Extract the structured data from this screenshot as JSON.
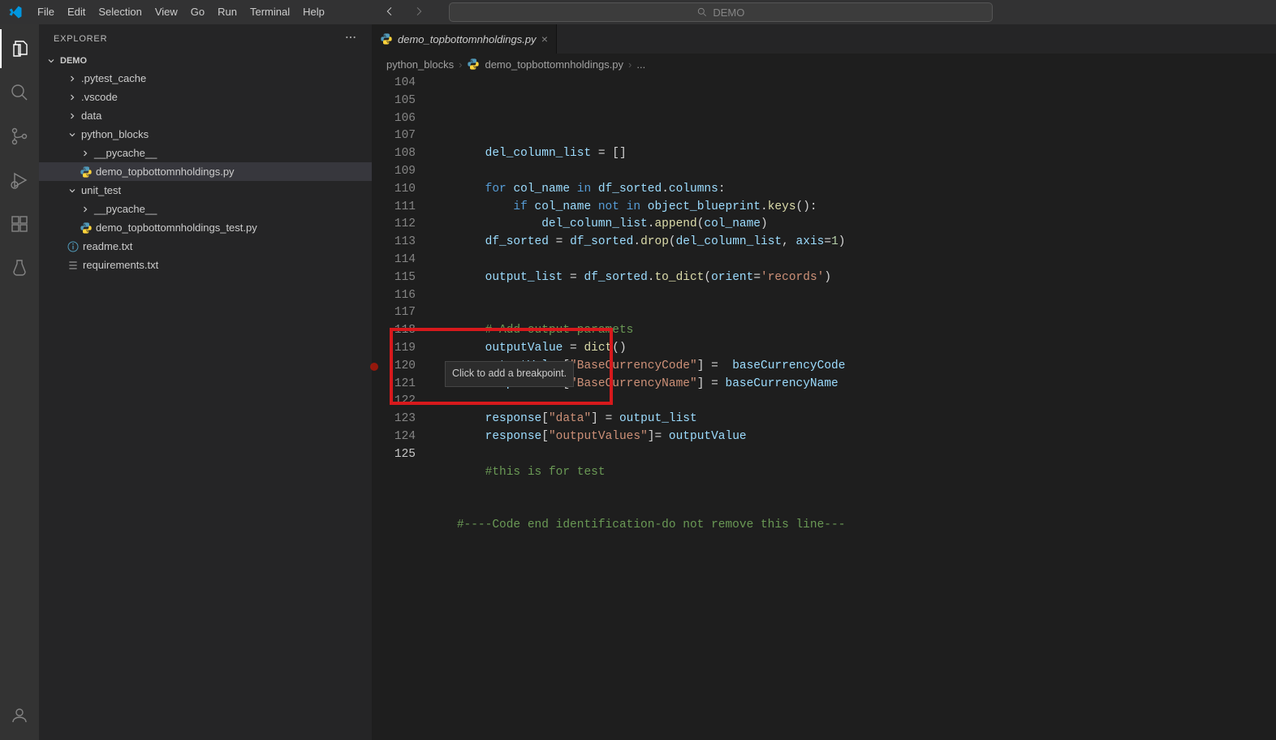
{
  "menubar": {
    "items": [
      "File",
      "Edit",
      "Selection",
      "View",
      "Go",
      "Run",
      "Terminal",
      "Help"
    ]
  },
  "search": {
    "text": "DEMO"
  },
  "explorer": {
    "title": "EXPLORER",
    "root": "DEMO",
    "tree": [
      {
        "name": ".pytest_cache",
        "kind": "folder-collapsed",
        "indent": 1
      },
      {
        "name": ".vscode",
        "kind": "folder-collapsed",
        "indent": 1
      },
      {
        "name": "data",
        "kind": "folder-collapsed",
        "indent": 1
      },
      {
        "name": "python_blocks",
        "kind": "folder-open",
        "indent": 1
      },
      {
        "name": "__pycache__",
        "kind": "folder-collapsed",
        "indent": 2
      },
      {
        "name": "demo_topbottomnholdings.py",
        "kind": "py",
        "indent": 2,
        "selected": true
      },
      {
        "name": "unit_test",
        "kind": "folder-open",
        "indent": 1
      },
      {
        "name": "__pycache__",
        "kind": "folder-collapsed",
        "indent": 2
      },
      {
        "name": "demo_topbottomnholdings_test.py",
        "kind": "py",
        "indent": 2
      },
      {
        "name": "readme.txt",
        "kind": "info",
        "indent": 1
      },
      {
        "name": "requirements.txt",
        "kind": "list",
        "indent": 1
      }
    ]
  },
  "tab": {
    "label": "demo_topbottomnholdings.py",
    "icon": "python"
  },
  "breadcrumbs": {
    "parts": [
      "python_blocks",
      "demo_topbottomnholdings.py",
      "..."
    ],
    "icon": "python"
  },
  "editor": {
    "startLine": 104,
    "currentLine": 125,
    "breakpointHoverLine": 120,
    "tooltip": "Click to add a breakpoint.",
    "lines": [
      {
        "n": 104,
        "tokens": [
          [
            "        ",
            ""
          ],
          [
            "del_column_list",
            "obj"
          ],
          [
            " = [",
            ""
          ],
          [
            "]",
            ""
          ]
        ]
      },
      {
        "n": 105,
        "tokens": [
          [
            "",
            ""
          ]
        ]
      },
      {
        "n": 106,
        "tokens": [
          [
            "        ",
            ""
          ],
          [
            "for",
            "kw"
          ],
          [
            " ",
            ""
          ],
          [
            "col_name",
            "obj"
          ],
          [
            " ",
            ""
          ],
          [
            "in",
            "kw"
          ],
          [
            " ",
            ""
          ],
          [
            "df_sorted",
            "obj"
          ],
          [
            ".",
            ""
          ],
          [
            "columns",
            "obj"
          ],
          [
            ":",
            ""
          ]
        ]
      },
      {
        "n": 107,
        "tokens": [
          [
            "            ",
            ""
          ],
          [
            "if",
            "kw"
          ],
          [
            " ",
            ""
          ],
          [
            "col_name",
            "obj"
          ],
          [
            " ",
            ""
          ],
          [
            "not",
            "kw"
          ],
          [
            " ",
            ""
          ],
          [
            "in",
            "kw"
          ],
          [
            " ",
            ""
          ],
          [
            "object_blueprint",
            "obj"
          ],
          [
            ".",
            ""
          ],
          [
            "keys",
            "fn"
          ],
          [
            "():",
            ""
          ]
        ]
      },
      {
        "n": 108,
        "tokens": [
          [
            "                ",
            ""
          ],
          [
            "del_column_list",
            "obj"
          ],
          [
            ".",
            ""
          ],
          [
            "append",
            "fn"
          ],
          [
            "(",
            ""
          ],
          [
            "col_name",
            "obj"
          ],
          [
            ")",
            ""
          ]
        ]
      },
      {
        "n": 109,
        "tokens": [
          [
            "        ",
            ""
          ],
          [
            "df_sorted",
            "obj"
          ],
          [
            " = ",
            ""
          ],
          [
            "df_sorted",
            "obj"
          ],
          [
            ".",
            ""
          ],
          [
            "drop",
            "fn"
          ],
          [
            "(",
            ""
          ],
          [
            "del_column_list",
            "obj"
          ],
          [
            ", ",
            ""
          ],
          [
            "axis",
            "obj"
          ],
          [
            "=",
            ""
          ],
          [
            "1",
            "num"
          ],
          [
            ")",
            ""
          ]
        ]
      },
      {
        "n": 110,
        "tokens": [
          [
            "",
            ""
          ]
        ]
      },
      {
        "n": 111,
        "tokens": [
          [
            "        ",
            ""
          ],
          [
            "output_list",
            "obj"
          ],
          [
            " = ",
            ""
          ],
          [
            "df_sorted",
            "obj"
          ],
          [
            ".",
            ""
          ],
          [
            "to_dict",
            "fn"
          ],
          [
            "(",
            ""
          ],
          [
            "orient",
            "obj"
          ],
          [
            "=",
            ""
          ],
          [
            "'records'",
            "str"
          ],
          [
            ")",
            ""
          ]
        ]
      },
      {
        "n": 112,
        "tokens": [
          [
            "",
            ""
          ]
        ]
      },
      {
        "n": 113,
        "tokens": [
          [
            "",
            ""
          ]
        ]
      },
      {
        "n": 114,
        "tokens": [
          [
            "        ",
            ""
          ],
          [
            "# Add output paramets",
            "com"
          ]
        ]
      },
      {
        "n": 115,
        "tokens": [
          [
            "        ",
            ""
          ],
          [
            "outputValue",
            "obj"
          ],
          [
            " = ",
            ""
          ],
          [
            "dict",
            "fn"
          ],
          [
            "()",
            ""
          ]
        ]
      },
      {
        "n": 116,
        "tokens": [
          [
            "        ",
            ""
          ],
          [
            "outputValue",
            "obj"
          ],
          [
            "[",
            ""
          ],
          [
            "\"BaseCurrencyCode\"",
            "str"
          ],
          [
            "] =  ",
            ""
          ],
          [
            "baseCurrencyCode",
            "obj"
          ]
        ]
      },
      {
        "n": 117,
        "tokens": [
          [
            "        ",
            ""
          ],
          [
            "outputValue",
            "obj"
          ],
          [
            "[",
            ""
          ],
          [
            "\"BaseCurrencyName\"",
            "str"
          ],
          [
            "] = ",
            ""
          ],
          [
            "baseCurrencyName",
            "obj"
          ]
        ]
      },
      {
        "n": 118,
        "tokens": [
          [
            "",
            ""
          ]
        ]
      },
      {
        "n": 119,
        "tokens": [
          [
            "        ",
            ""
          ],
          [
            "response",
            "obj"
          ],
          [
            "[",
            ""
          ],
          [
            "\"data\"",
            "str"
          ],
          [
            "] = ",
            ""
          ],
          [
            "output_list",
            "obj"
          ]
        ]
      },
      {
        "n": 120,
        "tokens": [
          [
            "        ",
            ""
          ],
          [
            "response",
            "obj"
          ],
          [
            "[",
            ""
          ],
          [
            "\"outputValues\"",
            "str"
          ],
          [
            "]= ",
            ""
          ],
          [
            "outputValue",
            "obj"
          ]
        ]
      },
      {
        "n": 121,
        "tokens": [
          [
            "",
            ""
          ]
        ]
      },
      {
        "n": 122,
        "tokens": [
          [
            "        ",
            ""
          ],
          [
            "#this is for test",
            "com"
          ]
        ]
      },
      {
        "n": 123,
        "tokens": [
          [
            "",
            ""
          ]
        ]
      },
      {
        "n": 124,
        "tokens": [
          [
            "",
            ""
          ]
        ]
      },
      {
        "n": 125,
        "tokens": [
          [
            "    ",
            ""
          ],
          [
            "#----Code end identification-do not remove this line---",
            "com"
          ]
        ]
      }
    ]
  }
}
